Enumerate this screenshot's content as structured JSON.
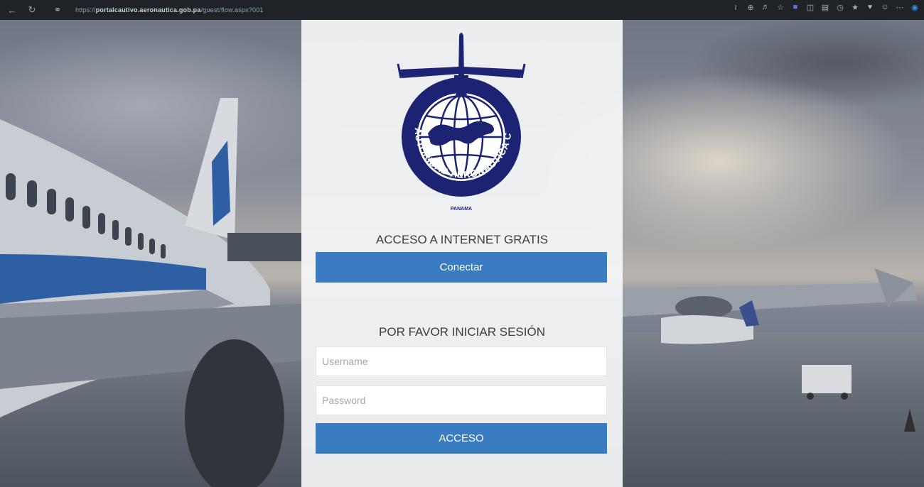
{
  "browser": {
    "url_prefix": "https://",
    "url_host": "portalcautivo.aeronautica.gob.pa",
    "url_path": "/guest/flow.aspx?001"
  },
  "logo": {
    "ring_text": "AUTORIDAD AERONÁUTICA CIVIL",
    "country": "PANAMA",
    "primary_color": "#1c2372"
  },
  "free_internet": {
    "heading": "ACCESO A INTERNET GRATIS",
    "connect_label": "Conectar"
  },
  "login": {
    "heading": "POR FAVOR INICIAR SESIÓN",
    "username_placeholder": "Username",
    "password_placeholder": "Password",
    "submit_label": "ACCESO"
  },
  "colors": {
    "button": "#3a7cc2",
    "card": "#f5f6f8"
  }
}
